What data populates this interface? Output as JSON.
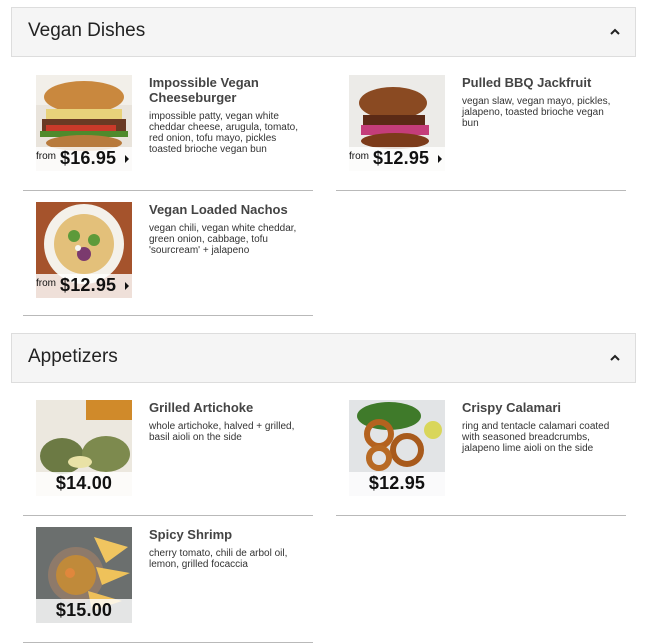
{
  "sections": [
    {
      "title": "Vegan Dishes",
      "items": [
        {
          "name": "Impossible Vegan Cheeseburger",
          "description": "impossible patty, vegan white cheddar cheese, arugula, tomato, red onion, tofu mayo, pickles toasted brioche vegan bun",
          "price_prefix": "from",
          "price": "$16.95",
          "image_icon": "burger-photo"
        },
        {
          "name": "Pulled BBQ Jackfruit",
          "description": "vegan slaw, vegan mayo, pickles, jalapeno, toasted brioche vegan bun",
          "price_prefix": "from",
          "price": "$12.95",
          "image_icon": "jackfruit-sandwich-photo"
        },
        {
          "name": "Vegan Loaded Nachos",
          "description": "vegan chili, vegan white cheddar, green onion, cabbage, tofu 'sourcream' + jalapeno",
          "price_prefix": "from",
          "price": "$12.95",
          "image_icon": "nachos-photo"
        }
      ]
    },
    {
      "title": "Appetizers",
      "items": [
        {
          "name": "Grilled Artichoke",
          "description": "whole artichoke, halved + grilled, basil aioli on the side",
          "price": "$14.00",
          "image_icon": "artichoke-photo"
        },
        {
          "name": "Crispy Calamari",
          "description": "ring and tentacle calamari coated with seasoned breadcrumbs, jalapeno lime aioli on the side",
          "price": "$12.95",
          "image_icon": "calamari-photo"
        },
        {
          "name": "Spicy Shrimp",
          "description": "cherry tomato, chili de arbol oil, lemon, grilled focaccia",
          "price": "$15.00",
          "image_icon": "shrimp-photo"
        }
      ]
    }
  ],
  "colors": {
    "header_bg": "#f5f5f5",
    "divider": "#b9b9b9",
    "text": "#333333"
  }
}
